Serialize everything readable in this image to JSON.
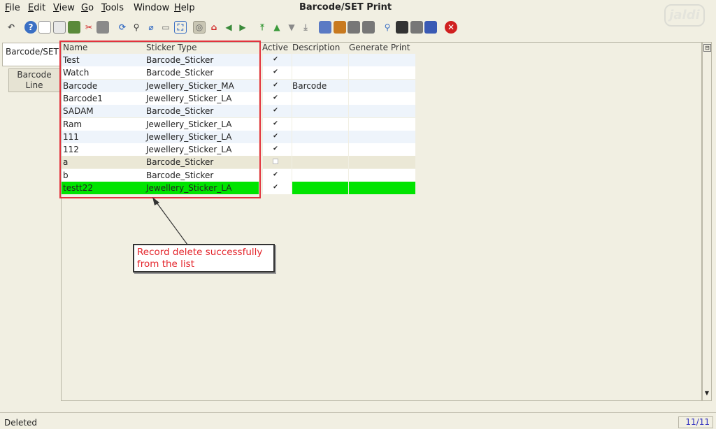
{
  "menu": {
    "file": {
      "u": "F",
      "rest": "ile"
    },
    "edit": {
      "u": "E",
      "rest": "dit"
    },
    "view": {
      "u": "V",
      "rest": "iew"
    },
    "go": {
      "u": "G",
      "rest": "o"
    },
    "tools": {
      "u": "T",
      "rest": "ools"
    },
    "window": "Window",
    "help": {
      "u": "H",
      "rest": "elp"
    }
  },
  "window_title": "Barcode/SET Print",
  "brand": "jaldi",
  "tabs": {
    "parent": "Barcode/SET",
    "child": "Barcode Line"
  },
  "grid": {
    "headers": {
      "name": "Name",
      "sticker_type": "Sticker Type",
      "active": "Active",
      "description": "Description",
      "generate_print": "Generate Print"
    },
    "rows": [
      {
        "name": "Test",
        "sticker_type": "Barcode_Sticker",
        "active": "✔",
        "description": ""
      },
      {
        "name": "Watch",
        "sticker_type": "Barcode_Sticker",
        "active": "✔",
        "description": ""
      },
      {
        "name": "Barcode",
        "sticker_type": "Jewellery_Sticker_MA",
        "active": "✔",
        "description": "Barcode"
      },
      {
        "name": "Barcode1",
        "sticker_type": "Jewellery_Sticker_LA",
        "active": "✔",
        "description": ""
      },
      {
        "name": "SADAM",
        "sticker_type": "Barcode_Sticker",
        "active": "✔",
        "description": ""
      },
      {
        "name": "Ram",
        "sticker_type": "Jewellery_Sticker_LA",
        "active": "✔",
        "description": ""
      },
      {
        "name": "111",
        "sticker_type": "Jewellery_Sticker_LA",
        "active": "✔",
        "description": ""
      },
      {
        "name": "112",
        "sticker_type": "Jewellery_Sticker_LA",
        "active": "✔",
        "description": ""
      },
      {
        "name": "a",
        "sticker_type": "Barcode_Sticker",
        "active": "",
        "description": ""
      },
      {
        "name": "b",
        "sticker_type": "Barcode_Sticker",
        "active": "✔",
        "description": ""
      },
      {
        "name": "testt22",
        "sticker_type": "Jewellery_Sticker_LA",
        "active": "✔",
        "description": ""
      }
    ]
  },
  "callout": {
    "line1": "Record delete successfully",
    "line2": "from the list"
  },
  "status": {
    "message": "Deleted",
    "record_count": "11/11"
  },
  "colors": {
    "selected_row": "#00e400",
    "alt_row": "#eef4fb",
    "highlight_border": "#e2323c",
    "callout_text": "#e4252c"
  }
}
